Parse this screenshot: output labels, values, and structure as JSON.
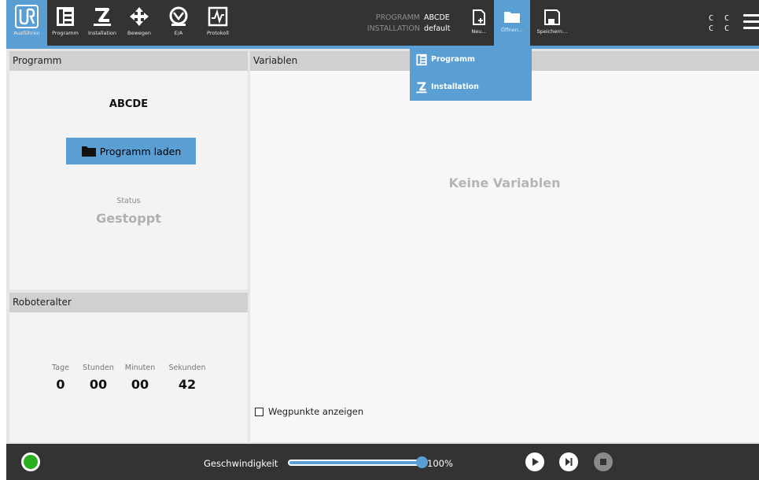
{
  "nav": [
    {
      "label": "Ausführen",
      "icon": "ur-logo-icon"
    },
    {
      "label": "Programm",
      "icon": "program-icon"
    },
    {
      "label": "Installation",
      "icon": "installation-icon"
    },
    {
      "label": "Bewegen",
      "icon": "move-icon"
    },
    {
      "label": "E/A",
      "icon": "io-icon"
    },
    {
      "label": "Protokoll",
      "icon": "log-icon"
    }
  ],
  "header": {
    "program_key": "PROGRAMM",
    "program_value": "ABCDE",
    "installation_key": "INSTALLATION",
    "installation_value": "default"
  },
  "file_buttons": {
    "new_label": "Neu...",
    "open_label": "Öffnen...",
    "save_label": "Speichern..."
  },
  "cc": {
    "row1": "C C",
    "row2": "C C"
  },
  "open_menu": {
    "items": [
      {
        "label": "Programm",
        "icon": "program-icon"
      },
      {
        "label": "Installation",
        "icon": "installation-icon"
      }
    ]
  },
  "program_panel": {
    "title": "Programm",
    "program_name": "ABCDE",
    "load_button": "Programm laden",
    "status_label": "Status",
    "status_value": "Gestoppt"
  },
  "age_panel": {
    "title": "Roboteralter",
    "fields": [
      {
        "label": "Tage",
        "value": "0"
      },
      {
        "label": "Stunden",
        "value": "00"
      },
      {
        "label": "Minuten",
        "value": "00"
      },
      {
        "label": "Sekunden",
        "value": "42"
      }
    ]
  },
  "variables_panel": {
    "title": "Variablen",
    "empty_text": "Keine Variablen",
    "show_waypoints": "Wegpunkte anzeigen",
    "show_waypoints_checked": false
  },
  "footer": {
    "speed_label": "Geschwindigkeit",
    "speed_value": "100%",
    "speed_fraction": 1.0,
    "colors": {
      "accent": "#5a9fd4",
      "power_on": "#2bb11f",
      "bar": "#333333"
    }
  }
}
